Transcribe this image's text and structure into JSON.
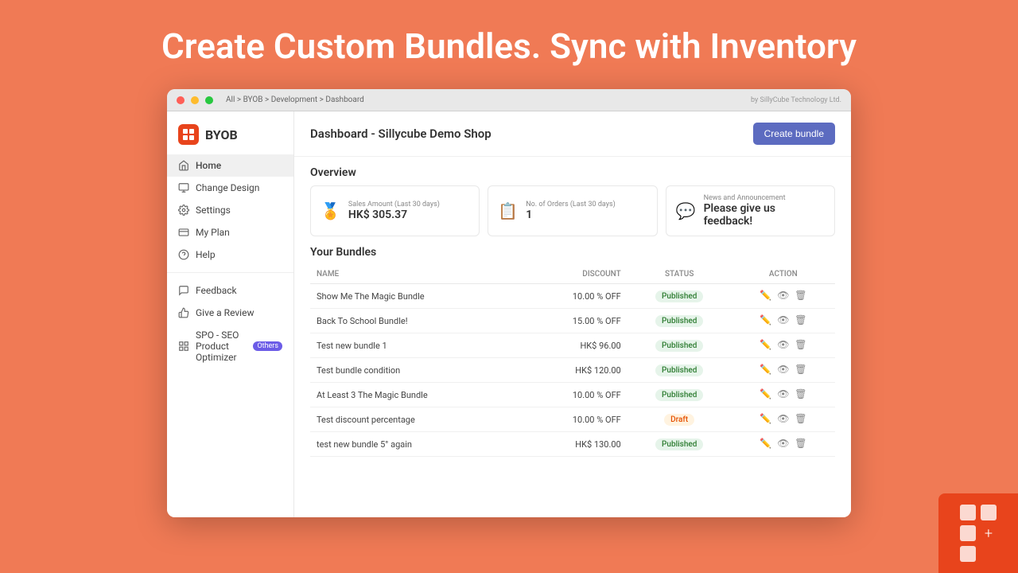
{
  "hero": {
    "text": "Create Custom Bundles. Sync with Inventory"
  },
  "browser": {
    "breadcrumb": "All > BYOB > Development > Dashboard",
    "by_label": "by SillyCube Technology Ltd."
  },
  "sidebar": {
    "logo": "BYOB",
    "nav_items": [
      {
        "id": "home",
        "label": "Home",
        "active": true
      },
      {
        "id": "change-design",
        "label": "Change Design",
        "active": false
      },
      {
        "id": "settings",
        "label": "Settings",
        "active": false
      },
      {
        "id": "my-plan",
        "label": "My Plan",
        "active": false
      },
      {
        "id": "help",
        "label": "Help",
        "active": false
      }
    ],
    "bottom_items": [
      {
        "id": "feedback",
        "label": "Feedback"
      },
      {
        "id": "give-review",
        "label": "Give a Review"
      }
    ],
    "app_item": {
      "label": "SPO - SEO Product Optimizer",
      "badge": "Others"
    }
  },
  "main": {
    "title": "Dashboard - Sillycube Demo Shop",
    "create_bundle_label": "Create bundle",
    "overview": {
      "title": "Overview",
      "cards": [
        {
          "icon": "🏅",
          "label": "Sales Amount (Last 30 days)",
          "value": "HK$ 305.37"
        },
        {
          "icon": "📋",
          "label": "No. of Orders (Last 30 days)",
          "value": "1"
        },
        {
          "icon": "💬",
          "label": "News and Announcement",
          "value": "Please give us feedback!"
        }
      ]
    },
    "bundles": {
      "title": "Your Bundles",
      "columns": [
        "NAME",
        "DISCOUNT",
        "STATUS",
        "ACTION"
      ],
      "rows": [
        {
          "name": "Show Me The Magic Bundle",
          "discount": "10.00 % OFF",
          "status": "Published"
        },
        {
          "name": "Back To School Bundle!",
          "discount": "15.00 % OFF",
          "status": "Published"
        },
        {
          "name": "Test new bundle 1",
          "discount": "HK$ 96.00",
          "status": "Published"
        },
        {
          "name": "Test bundle condition",
          "discount": "HK$ 120.00",
          "status": "Published"
        },
        {
          "name": "At Least 3 The Magic Bundle",
          "discount": "10.00 % OFF",
          "status": "Published"
        },
        {
          "name": "Test discount percentage",
          "discount": "10.00 % OFF",
          "status": "Draft"
        },
        {
          "name": "test new bundle 5° again",
          "discount": "HK$ 130.00",
          "status": "Published"
        }
      ]
    }
  }
}
